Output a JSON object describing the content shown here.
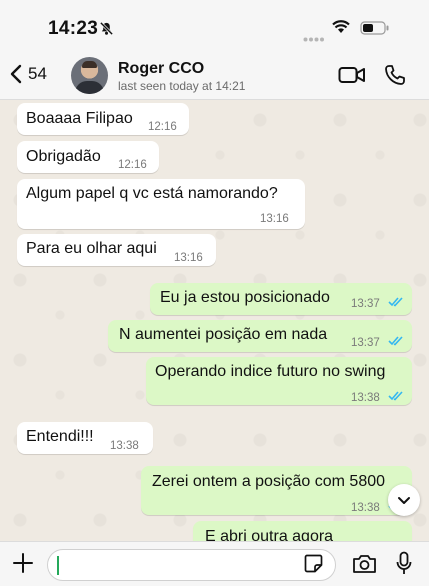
{
  "status_bar": {
    "time": "14:23"
  },
  "header": {
    "back_count": "54",
    "contact_name": "Roger CCO",
    "contact_status": "last seen today at 14:21"
  },
  "messages": [
    {
      "direction": "in",
      "text": "Boaaaa Filipao",
      "time": "12:16"
    },
    {
      "direction": "in",
      "text": "Obrigadão",
      "time": "12:16"
    },
    {
      "direction": "in",
      "text": "Algum papel q vc está namorando?",
      "time": "13:16"
    },
    {
      "direction": "in",
      "text": "Para eu olhar aqui",
      "time": "13:16"
    },
    {
      "direction": "out",
      "text": "Eu ja estou posicionado",
      "time": "13:37",
      "status": "read"
    },
    {
      "direction": "out",
      "text": "N aumentei posição em nada",
      "time": "13:37",
      "status": "read"
    },
    {
      "direction": "out",
      "text": "Operando indice futuro no swing",
      "time": "13:38",
      "status": "read"
    },
    {
      "direction": "in",
      "text": "Entendi!!!",
      "time": "13:38"
    },
    {
      "direction": "out",
      "text": "Zerei ontem a posição com 5800",
      "time": "13:38",
      "status": "read"
    },
    {
      "direction": "out",
      "text": "E abri outra agora",
      "time": "",
      "status": ""
    }
  ],
  "input": {
    "placeholder": ""
  },
  "colors": {
    "outgoing_bubble": "#dcf8c6",
    "incoming_bubble": "#ffffff",
    "read_tick": "#34b7f1",
    "chat_background": "#efeae2"
  },
  "icons": [
    "bell-slash-icon",
    "signal-dots-icon",
    "wifi-icon",
    "battery-icon",
    "back-chevron-icon",
    "video-call-icon",
    "phone-call-icon",
    "read-ticks-icon",
    "chevron-down-icon",
    "plus-icon",
    "sticker-icon",
    "camera-icon",
    "microphone-icon"
  ]
}
